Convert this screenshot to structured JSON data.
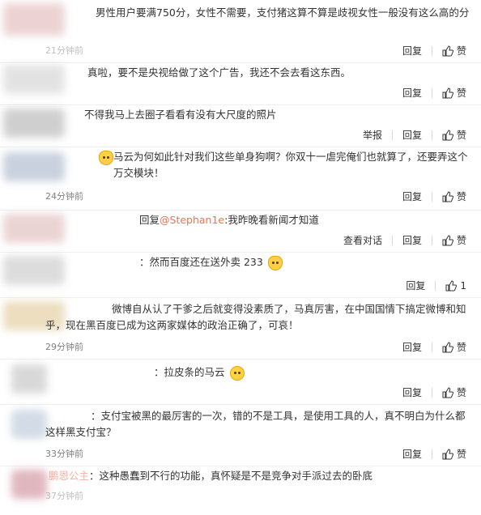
{
  "actions": {
    "reply": "回复",
    "like": "赞",
    "report": "举报",
    "view_conversation": "查看对话"
  },
  "comments": [
    {
      "text": "男性用户要满750分，女性不需要，支付猪这算不算是歧视女性一般没有这么高的分",
      "time": "21分钟前",
      "avatar_color": "#e8c8c8"
    },
    {
      "text": "真啦，要不是央视给做了这个广告，我还不会去看这东西。",
      "time": "",
      "avatar_color": "#d7d7d7"
    },
    {
      "text": "不得我马上去圈子看看有没有大尺度的照片",
      "time": "",
      "avatar_color": "#c8c8c8"
    },
    {
      "text": "马云为何如此针对我们这些单身狗啊？你双十一虐完俺们也就算了，还要弄这个万交模块！",
      "time": "24分钟前",
      "avatar_color": "#bcc6d6"
    },
    {
      "text_prefix": "回复",
      "mention": "@Stephan1e",
      "text": ":我昨晚看新闻才知道",
      "time": "",
      "avatar_color": "#e6c9c9"
    },
    {
      "text": "：然而百度还在送外卖 233",
      "time": "",
      "like_count": "1",
      "avatar_color": "#d4d4d4"
    },
    {
      "text": "微博自从认了干爹之后就变得没素质了，马真厉害，在中国国情下搞定微博和知乎，现在黑百度已成为这两家媒体的政治正确了，可哀！",
      "time": "29分钟前",
      "avatar_color": "#e8d6b0"
    },
    {
      "text": "：拉皮条的马云",
      "time": "",
      "avatar_color": "#cfcfcf"
    },
    {
      "text": "：支付宝被黑的最厉害的一次，错的不是工具，是使用工具的人，真不明白为什么都这样黑支付宝？",
      "time": "33分钟前",
      "avatar_color": "#c7d3e0"
    },
    {
      "name": "鹏恩公主",
      "text": "：这种愚蠢到不行的功能，真怀疑是不是竞争对手派过去的卧底",
      "time": "37分钟前",
      "avatar_color": "#d9a5b0"
    }
  ]
}
